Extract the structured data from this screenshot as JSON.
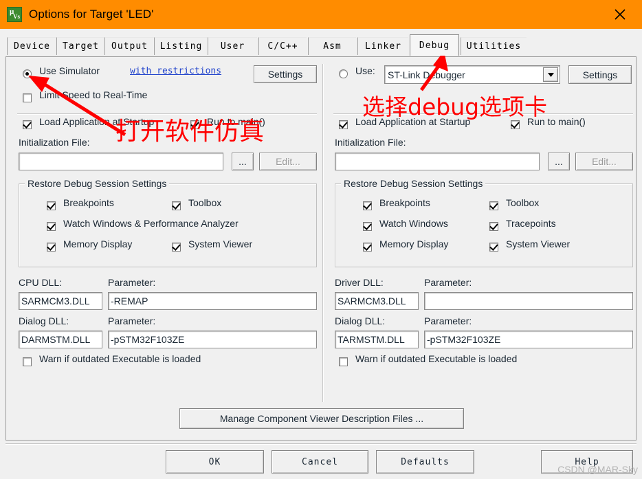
{
  "window": {
    "title": "Options for Target 'LED'",
    "icon": "uvision-icon",
    "titlebar_color": "#ff8c00",
    "close_label": "close-icon"
  },
  "tabs": [
    {
      "label": "Device",
      "selected": false
    },
    {
      "label": "Target",
      "selected": false
    },
    {
      "label": "Output",
      "selected": false
    },
    {
      "label": "Listing",
      "selected": false
    },
    {
      "label": "User",
      "selected": false
    },
    {
      "label": "C/C++",
      "selected": false
    },
    {
      "label": "Asm",
      "selected": false
    },
    {
      "label": "Linker",
      "selected": false
    },
    {
      "label": "Debug",
      "selected": true
    },
    {
      "label": "Utilities",
      "selected": false
    }
  ],
  "left": {
    "use_simulator_label": "Use Simulator",
    "use_simulator_checked": true,
    "restrictions_link": "with restrictions",
    "settings_button": "Settings",
    "limit_speed_label": "Limit Speed to Real-Time",
    "limit_speed_checked": false,
    "load_app_label": "Load Application at Startup",
    "load_app_checked": true,
    "run_to_main_label": "Run to main()",
    "run_to_main_checked": true,
    "init_file_label": "Initialization File:",
    "init_file_value": "",
    "browse_button": "...",
    "edit_button": "Edit...",
    "restore_group_title": "Restore Debug Session Settings",
    "restore_items": [
      {
        "label": "Breakpoints",
        "checked": true
      },
      {
        "label": "Toolbox",
        "checked": true
      },
      {
        "label": "Watch Windows & Performance Analyzer",
        "checked": true
      },
      {
        "label": "Memory Display",
        "checked": true
      },
      {
        "label": "System Viewer",
        "checked": true
      }
    ],
    "cpu_dll_label": "CPU DLL:",
    "cpu_dll_value": "SARMCM3.DLL",
    "cpu_param_label": "Parameter:",
    "cpu_param_value": "-REMAP",
    "dialog_dll_label": "Dialog DLL:",
    "dialog_dll_value": "DARMSTM.DLL",
    "dialog_param_label": "Parameter:",
    "dialog_param_value": "-pSTM32F103ZE",
    "warn_label": "Warn if outdated Executable is loaded",
    "warn_checked": false
  },
  "right": {
    "use_label": "Use:",
    "use_checked": false,
    "debugger_value": "ST-Link Debugger",
    "settings_button": "Settings",
    "load_app_label": "Load Application at Startup",
    "load_app_checked": true,
    "run_to_main_label": "Run to main()",
    "run_to_main_checked": true,
    "init_file_label": "Initialization File:",
    "init_file_value": "",
    "browse_button": "...",
    "edit_button": "Edit...",
    "restore_group_title": "Restore Debug Session Settings",
    "restore_items": [
      {
        "label": "Breakpoints",
        "checked": true
      },
      {
        "label": "Toolbox",
        "checked": true
      },
      {
        "label": "Watch Windows",
        "checked": true
      },
      {
        "label": "Tracepoints",
        "checked": true
      },
      {
        "label": "Memory Display",
        "checked": true
      },
      {
        "label": "System Viewer",
        "checked": true
      }
    ],
    "driver_dll_label": "Driver DLL:",
    "driver_dll_value": "SARMCM3.DLL",
    "driver_param_label": "Parameter:",
    "driver_param_value": "",
    "dialog_dll_label": "Dialog DLL:",
    "dialog_dll_value": "TARMSTM.DLL",
    "dialog_param_label": "Parameter:",
    "dialog_param_value": "-pSTM32F103ZE",
    "warn_label": "Warn if outdated Executable is loaded",
    "warn_checked": false
  },
  "footer": {
    "manage_button": "Manage Component Viewer Description Files ...",
    "ok_button": "OK",
    "cancel_button": "Cancel",
    "defaults_button": "Defaults",
    "help_button": "Help"
  },
  "annotations": {
    "note_left": "打开软件仿真",
    "note_right": "选择debug选项卡",
    "arrow_color": "#ff0000",
    "watermark": "CSDN @MAR-Sky"
  }
}
